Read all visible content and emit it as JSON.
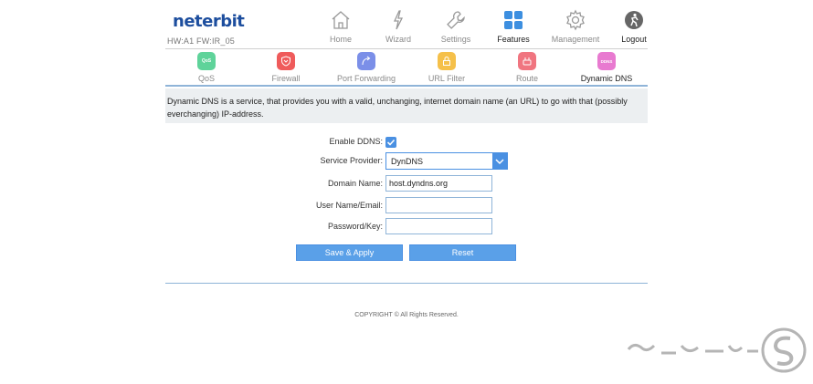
{
  "brand": {
    "logo": "neterbit",
    "hw_fw": "HW:A1 FW:IR_05"
  },
  "nav": [
    {
      "label": "Home",
      "icon": "home-icon"
    },
    {
      "label": "Wizard",
      "icon": "wizard-icon"
    },
    {
      "label": "Settings",
      "icon": "wrench-icon"
    },
    {
      "label": "Features",
      "icon": "grid-icon",
      "active": true
    },
    {
      "label": "Management",
      "icon": "gear-icon"
    },
    {
      "label": "Logout",
      "icon": "logout-icon"
    }
  ],
  "subnav": [
    {
      "label": "QoS",
      "icon": "qos-icon",
      "icon_text": "QoS",
      "color": "#5fd39a"
    },
    {
      "label": "Firewall",
      "icon": "firewall-icon",
      "color": "#ef5b5b"
    },
    {
      "label": "Port Forwarding",
      "icon": "port-forwarding-icon",
      "color": "#7b8fe8"
    },
    {
      "label": "URL Filter",
      "icon": "url-filter-icon",
      "color": "#f5c04a"
    },
    {
      "label": "Route",
      "icon": "route-icon",
      "color": "#f07580"
    },
    {
      "label": "Dynamic DNS",
      "icon": "ddns-icon",
      "icon_text": "DDNS",
      "color": "#e87ad0",
      "active": true
    }
  ],
  "description": "Dynamic DNS is a service, that provides you with a valid, unchanging, internet domain name (an URL) to go with that (possibly everchanging) IP-address.",
  "form": {
    "enable_label": "Enable DDNS:",
    "enable_checked": true,
    "provider_label": "Service Provider:",
    "provider_value": "DynDNS",
    "domain_label": "Domain Name:",
    "domain_value": "host.dyndns.org",
    "user_label": "User Name/Email:",
    "user_value": "",
    "password_label": "Password/Key:",
    "password_value": ""
  },
  "buttons": {
    "save": "Save & Apply",
    "reset": "Reset"
  },
  "copyright": "COPYRIGHT © All Rights Reserved.",
  "colors": {
    "accent": "#4a90e2",
    "button": "#5aa0e8",
    "brand": "#1d4e9e"
  }
}
